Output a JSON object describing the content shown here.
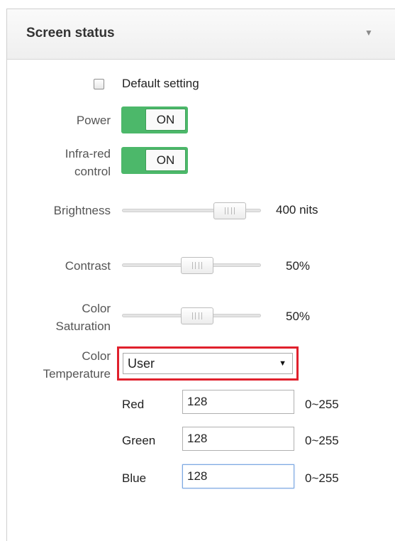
{
  "panel": {
    "title": "Screen status",
    "collapse_icon": "▼"
  },
  "default_setting": {
    "label": "Default setting",
    "checked": false
  },
  "power": {
    "label": "Power",
    "state": "ON"
  },
  "infrared": {
    "label_line1": "Infra-red",
    "label_line2": "control",
    "state": "ON"
  },
  "brightness": {
    "label": "Brightness",
    "value_text": "400 nits"
  },
  "contrast": {
    "label": "Contrast",
    "value_text": "50%"
  },
  "saturation": {
    "label_line1": "Color",
    "label_line2": "Saturation",
    "value_text": "50%"
  },
  "temperature": {
    "label_line1": "Color",
    "label_line2": "Temperature",
    "selected": "User",
    "arrow": "▼"
  },
  "rgb": [
    {
      "label": "Red",
      "value": "128",
      "range": "0~255"
    },
    {
      "label": "Green",
      "value": "128",
      "range": "0~255"
    },
    {
      "label": "Blue",
      "value": "128",
      "range": "0~255"
    }
  ],
  "colors": {
    "toggle_on": "#4cb86a",
    "highlight": "#e0202c"
  }
}
